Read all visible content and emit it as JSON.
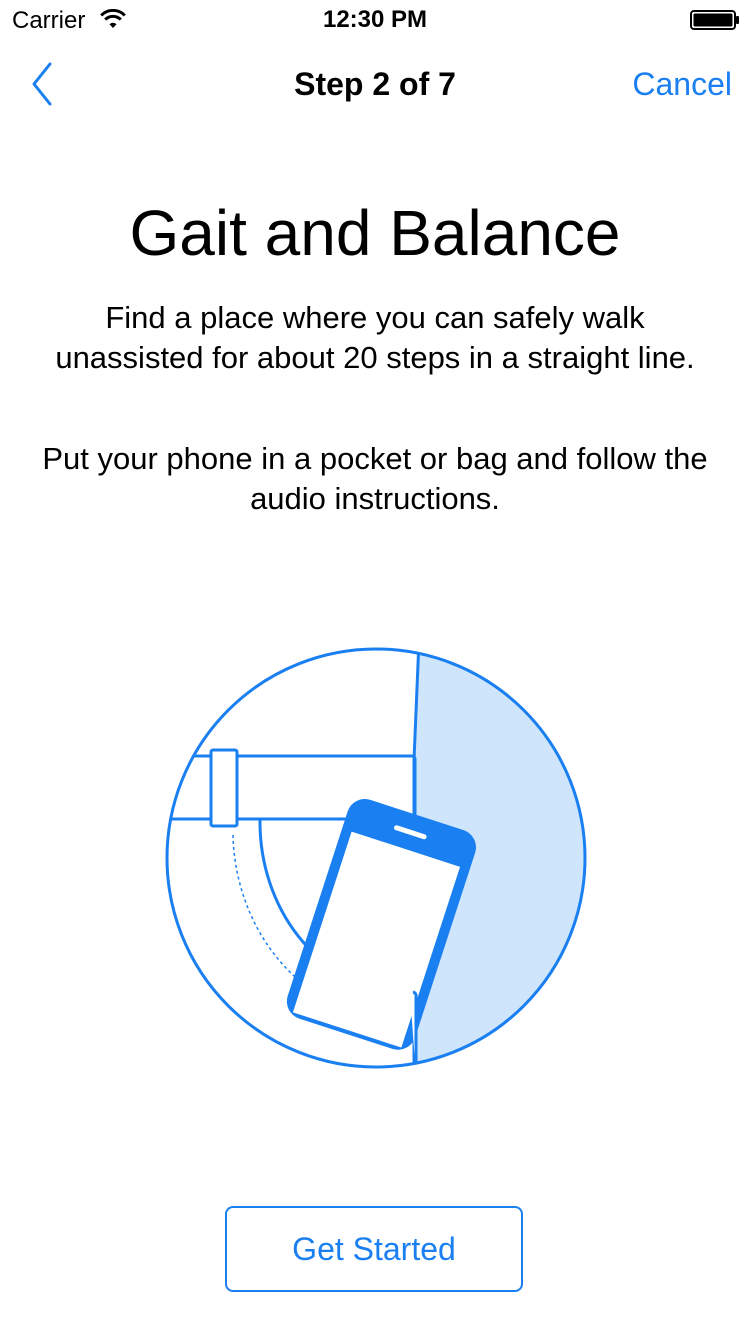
{
  "status_bar": {
    "carrier": "Carrier",
    "time": "12:30 PM",
    "wifi_icon": "wifi-icon",
    "battery_icon": "battery-icon"
  },
  "nav": {
    "back_icon": "chevron-left-icon",
    "title": "Step 2 of 7",
    "cancel_label": "Cancel"
  },
  "content": {
    "title": "Gait and Balance",
    "paragraphs": [
      "Find a place where you can safely walk unassisted for about 20 steps in a straight line.",
      "Put your phone in a pocket or bag and follow the audio instructions."
    ],
    "illustration_icon": "phone-in-pocket-illustration"
  },
  "actions": {
    "get_started_label": "Get Started"
  },
  "colors": {
    "accent": "#1a7ff0",
    "illustration_fill": "#cfe5fb",
    "text": "#000000",
    "background": "#ffffff"
  }
}
